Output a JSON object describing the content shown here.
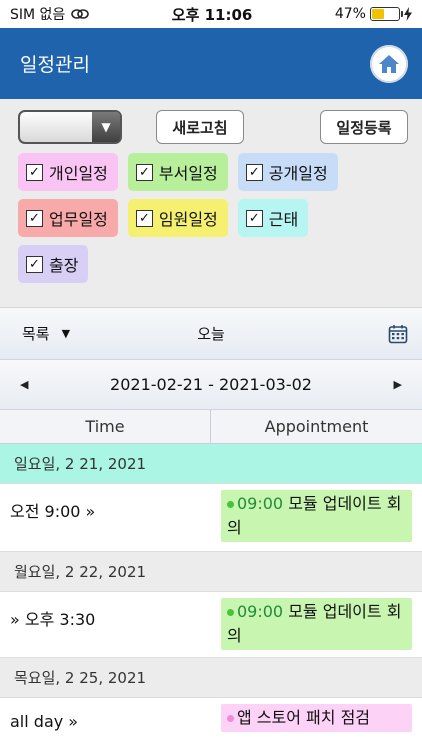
{
  "status": {
    "carrier": "SIM 없음",
    "time": "오후 11:06",
    "battery": "47%",
    "battery_level": 0.47
  },
  "header": {
    "title": "일정관리"
  },
  "filters": {
    "select_value": "",
    "refresh_label": "새로고침",
    "register_label": "일정등록",
    "chips": [
      {
        "label": "개인일정",
        "color": "#f9c4f3",
        "checked": true
      },
      {
        "label": "부서일정",
        "color": "#b8ef9a",
        "checked": true
      },
      {
        "label": "공개일정",
        "color": "#c7dcf7",
        "checked": true
      },
      {
        "label": "업무일정",
        "color": "#f8aaaa",
        "checked": true
      },
      {
        "label": "임원일정",
        "color": "#f6f071",
        "checked": true
      },
      {
        "label": "근태",
        "color": "#b7f5f2",
        "checked": true
      },
      {
        "label": "출장",
        "color": "#d8d0f4",
        "checked": true
      }
    ]
  },
  "list": {
    "mode_label": "목록",
    "today_label": "오늘",
    "range": "2021-02-21 - 2021-03-02",
    "col_time": "Time",
    "col_appt": "Appointment",
    "days": [
      {
        "label": "일요일, 2 21, 2021",
        "today": true,
        "events": [
          {
            "time": "오전 9:00 »",
            "clock": "09:00",
            "title": "모듈 업데이트 회의",
            "bg": "#c8f5b0",
            "dot": "#48c23a"
          }
        ]
      },
      {
        "label": "월요일, 2 22, 2021",
        "today": false,
        "events": [
          {
            "time": "» 오후 3:30",
            "clock": "09:00",
            "title": "모듈 업데이트 회의",
            "bg": "#c8f5b0",
            "dot": "#48c23a"
          }
        ]
      },
      {
        "label": "목요일, 2 25, 2021",
        "today": false,
        "events": [
          {
            "time": "all day »",
            "clock": "",
            "title": "앱 스토어 패치 점검",
            "bg": "#fcd2f6",
            "dot": "#f08bd9"
          }
        ]
      }
    ]
  }
}
